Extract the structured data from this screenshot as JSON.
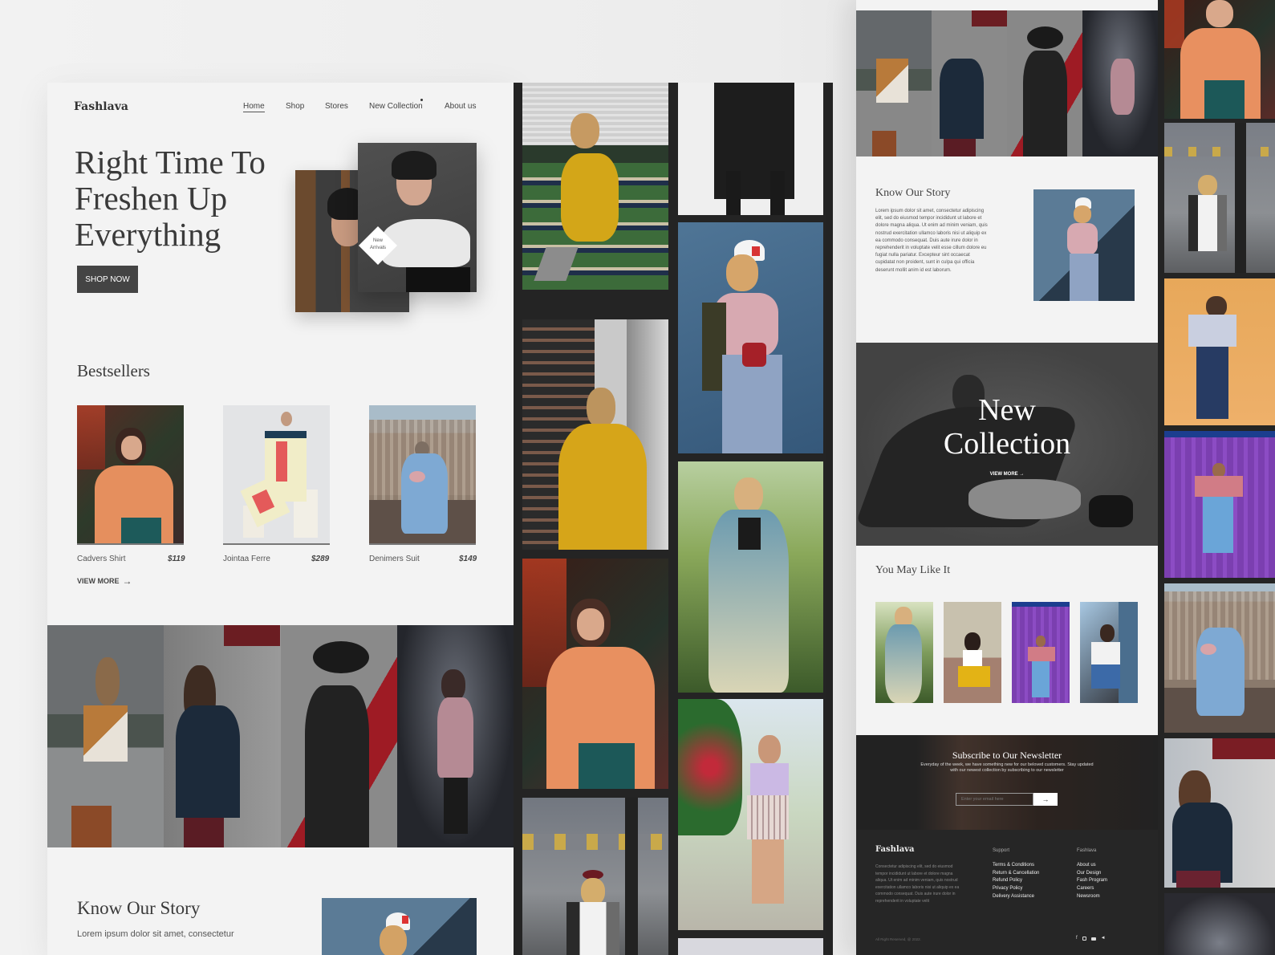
{
  "brand": "Fashlava",
  "nav": {
    "items": [
      "Home",
      "Shop",
      "Stores",
      "New Collection",
      "About us"
    ],
    "active": "Home"
  },
  "hero": {
    "title_lines": [
      "Right Time To",
      "Freshen Up",
      "Everything"
    ],
    "cta": "SHOP NOW",
    "badge_lines": [
      "New",
      "Arrivals"
    ]
  },
  "bestsellers": {
    "title": "Bestsellers",
    "products": [
      {
        "name": "Cadvers Shirt",
        "price": "$119"
      },
      {
        "name": "Jointaa Ferre",
        "price": "$289"
      },
      {
        "name": "Denimers Suit",
        "price": "$149"
      }
    ],
    "view_more": "VIEW MORE"
  },
  "story": {
    "title": "Know Our Story",
    "body": "Lorem ipsum dolor sit amet, consectetur adipiscing elit, sed do eiusmod tempor incididunt ut labore et dolore magna aliqua. Ut enim ad minim veniam, quis nostrud exercitation ullamco laboris nisi ut aliquip ex ea commodo consequat. Duis aute irure dolor in reprehenderit in voluptate velit esse cillum dolore eu fugiat nulla pariatur. Excepteur sint occaecat cupidatat non proident, sunt in culpa qui officia deserunt mollit anim id est laborum.",
    "body_short": "Lorem ipsum dolor sit amet, consectetur"
  },
  "new_collection": {
    "title_lines": [
      "New",
      "Collection"
    ],
    "view_more": "VIEW MORE"
  },
  "you_may_like": {
    "title": "You May Like It"
  },
  "newsletter": {
    "title": "Subscribe to Our Newsletter",
    "body": "Everyday of the week, we have something new for our beloved customers. Stay updated with our newest collection by subscribing to our newsletter",
    "placeholder": "Enter your email here",
    "submit_icon": "arrow-right-icon"
  },
  "footer": {
    "brand": "Fashlava",
    "about": "Consectetur adipiscing elit, sed do eiusmod tempor incididunt ut labore et dolore magna aliqua. Ut enim ad minim veniam, quis nostrud exercitation ullamco laboris nisi ut aliquip ex ea commodo consequat. Duis aute irure dolor in reprehenderit in voluptate velit",
    "support_title": "Support",
    "support_links": [
      "Terms & Conditions",
      "Return & Cancellation",
      "Refund Policy",
      "Privacy Policy",
      "Delivery Assistance"
    ],
    "company_title": "Fashlava",
    "company_links": [
      "About us",
      "Our Design",
      "Fash Program",
      "Careers",
      "Newsroom"
    ],
    "copyright": "All Right Reserved, @ 2022.",
    "social_icons": [
      "facebook-icon",
      "instagram-icon",
      "youtube-icon",
      "twitter-icon"
    ]
  },
  "colors": {
    "page_bg": "#f3f3f3",
    "dark": "#444444",
    "footer_bg": "#262626",
    "gallery_bg": "#242424"
  }
}
